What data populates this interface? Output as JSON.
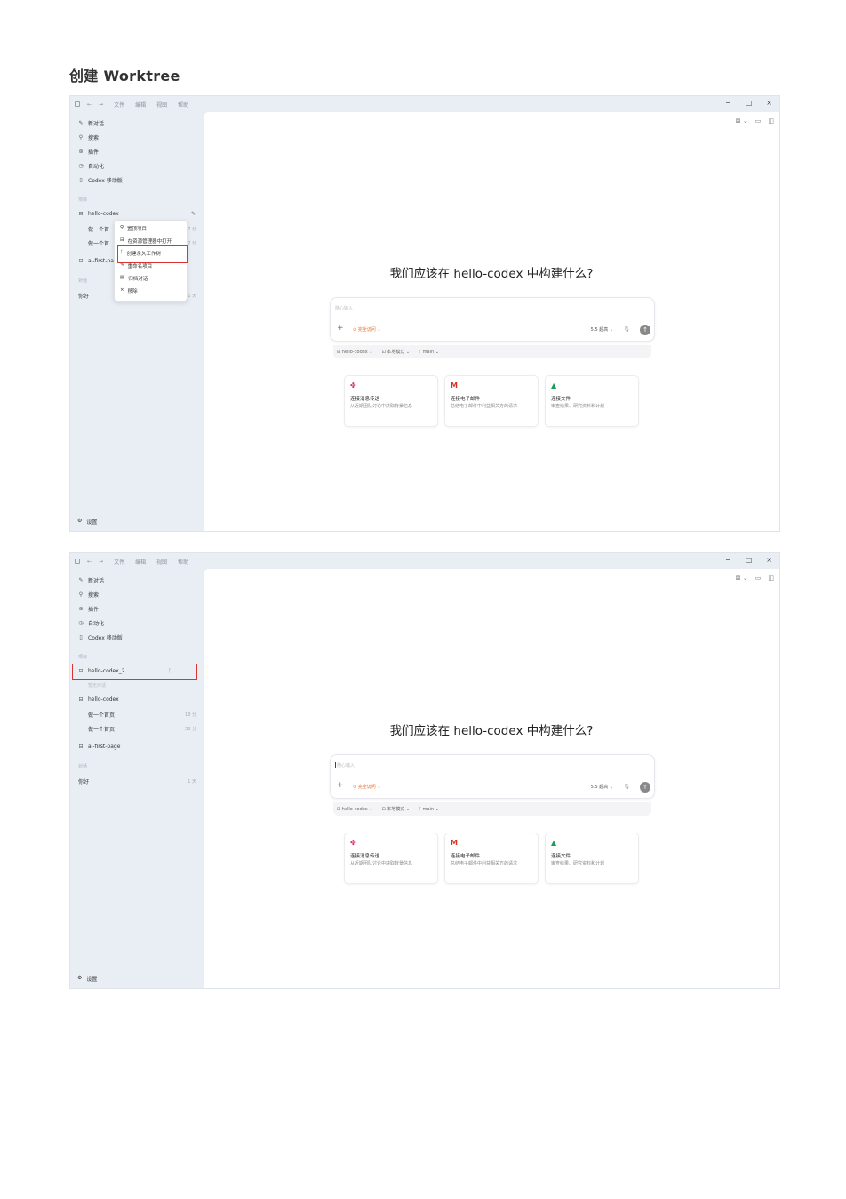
{
  "doc_title": "创建 Worktree",
  "titlebar": {
    "nav_back": "←",
    "nav_forward": "→",
    "menus": [
      "文件",
      "编辑",
      "视图",
      "帮助"
    ],
    "minimize": "−",
    "maximize": "□",
    "close": "×"
  },
  "sidebar": {
    "new_chat": "新对话",
    "search": "搜索",
    "plugins": "插件",
    "automation": "自动化",
    "mobile": "Codex 移动版",
    "projects_header": "项目",
    "chats_header": "对话",
    "settings": "设置"
  },
  "shot1": {
    "project_main": "hello-codex",
    "row1": "做一个首",
    "row1_time": "7 分",
    "row2": "做一个首",
    "row2_time": "7 分",
    "project_second": "ai-first-pa",
    "chat1": "你好",
    "chat1_time": "1 天",
    "project_more": "···",
    "context_menu": [
      "置顶项目",
      "在资源管理器中打开",
      "创建永久工作树",
      "重命名项目",
      "归档对话",
      "移除"
    ]
  },
  "shot2": {
    "worktree_project": "hello-codex_2",
    "no_chats": "暂无对话",
    "project_main": "hello-codex",
    "row1": "做一个首页",
    "row1_time": "18 分",
    "row2": "做一个首页",
    "row2_time": "38 分",
    "project_second": "ai-first-page",
    "chat1": "你好",
    "chat1_time": "1 天"
  },
  "main": {
    "heading": "我们应该在 hello-codex 中构建什么?",
    "placeholder": "随心输入",
    "plus": "+",
    "access": "⊙ 完全访问 ⌄",
    "model": "5.5 超高 ⌄",
    "mic": "🎙",
    "send": "↑",
    "toolbar": [
      "⊟ hello-codex ⌄",
      "⊡ 本地模式 ⌄",
      "ᚴ main ⌄"
    ],
    "top_icons": [
      "⊠ ⌄",
      "▭",
      "◫"
    ],
    "cards": [
      {
        "icon": "slack-icon",
        "glyph": "✤",
        "color": "#d3305b",
        "title": "连接消息传送",
        "desc": "从近期团队讨论中获取背景信息"
      },
      {
        "icon": "gmail-icon",
        "glyph": "M",
        "color": "#d93025",
        "title": "连接电子邮件",
        "desc": "总结电子邮件中利益相关方的请求"
      },
      {
        "icon": "drive-icon",
        "glyph": "▲",
        "color": "#1a9e5a",
        "title": "连接文件",
        "desc": "审查结果、研究资料和计划"
      }
    ]
  }
}
